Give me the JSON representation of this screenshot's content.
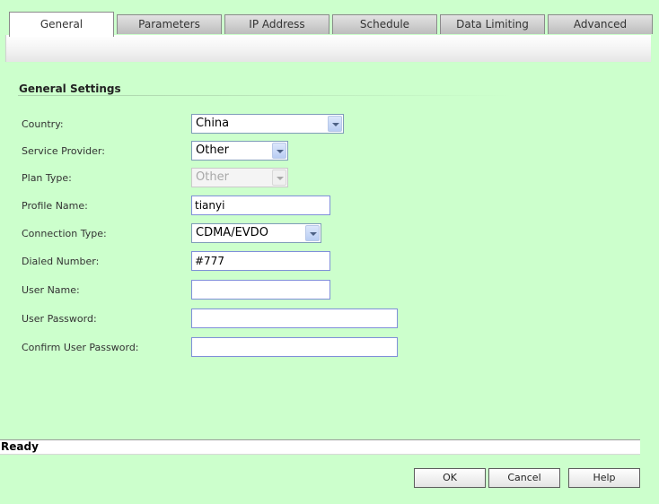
{
  "tabs": [
    {
      "label": "General",
      "active": true
    },
    {
      "label": "Parameters",
      "active": false
    },
    {
      "label": "IP Address",
      "active": false
    },
    {
      "label": "Schedule",
      "active": false
    },
    {
      "label": "Data Limiting",
      "active": false
    },
    {
      "label": "Advanced",
      "active": false
    }
  ],
  "section": {
    "title": "General Settings"
  },
  "form": {
    "country": {
      "label": "Country:",
      "value": "China"
    },
    "service_provider": {
      "label": "Service Provider:",
      "value": "Other"
    },
    "plan_type": {
      "label": "Plan Type:",
      "value": "Other",
      "disabled": true
    },
    "profile_name": {
      "label": "Profile Name:",
      "value": "tianyi"
    },
    "connection_type": {
      "label": "Connection Type:",
      "value": "CDMA/EVDO"
    },
    "dialed_number": {
      "label": "Dialed Number:",
      "value": "#777"
    },
    "user_name": {
      "label": "User Name:",
      "value": ""
    },
    "user_password": {
      "label": "User Password:",
      "value": ""
    },
    "confirm_password": {
      "label": "Confirm User Password:",
      "value": ""
    }
  },
  "status": {
    "text": "Ready"
  },
  "buttons": {
    "ok": "OK",
    "cancel": "Cancel",
    "help": "Help"
  },
  "colors": {
    "background": "#ccffcc",
    "field_border": "#7f8fd9"
  }
}
